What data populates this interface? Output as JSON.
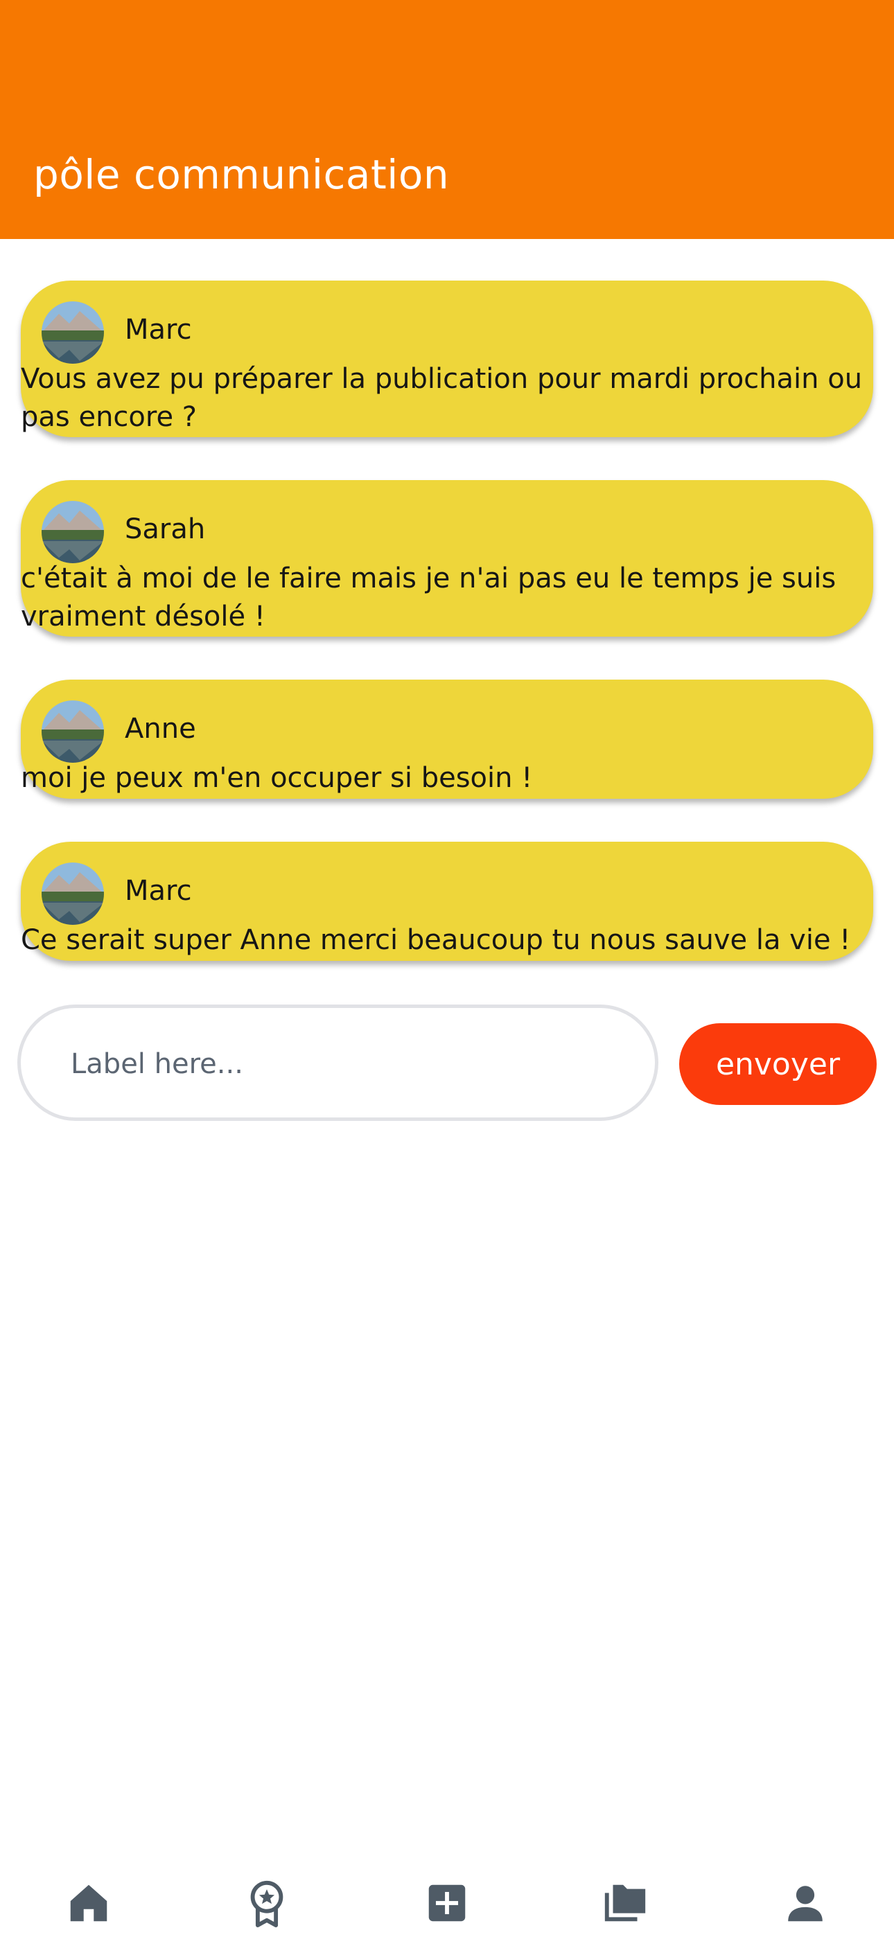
{
  "header": {
    "title": "pôle communication"
  },
  "messages": [
    {
      "sender": "Marc",
      "text": "Vous avez pu préparer la publication pour mardi prochain ou pas encore ?"
    },
    {
      "sender": "Sarah",
      "text": "c'était à moi de le faire mais je n'ai pas eu le temps je suis vraiment désolé !"
    },
    {
      "sender": "Anne",
      "text": "moi je peux m'en occuper si besoin !"
    },
    {
      "sender": "Marc",
      "text": "Ce serait super Anne merci beaucoup tu nous sauve la vie !"
    }
  ],
  "composer": {
    "placeholder": "Label here...",
    "value": "",
    "send_label": "envoyer"
  },
  "bottom_nav": [
    {
      "icon": "home-icon"
    },
    {
      "icon": "award-ribbon-icon"
    },
    {
      "icon": "add-box-icon"
    },
    {
      "icon": "folders-icon"
    },
    {
      "icon": "person-icon"
    }
  ],
  "colors": {
    "header": "#f67801",
    "bubble": "#eed63a",
    "send_button": "#fb3b0c",
    "nav_icon": "#4f5b66"
  }
}
